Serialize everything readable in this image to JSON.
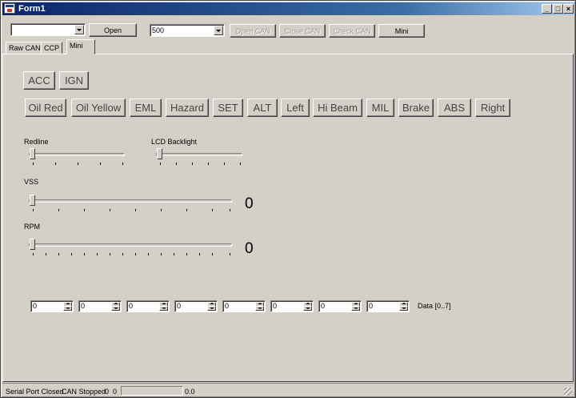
{
  "window": {
    "title": "Form1"
  },
  "toolbar": {
    "port_combo_value": "",
    "open_label": "Open",
    "baud_combo_value": "500",
    "open_can_label": "Open CAN",
    "close_can_label": "Close CAN",
    "check_can_label": "Check CAN",
    "mini_label": "Mini"
  },
  "tabs": [
    {
      "label": "Raw CAN"
    },
    {
      "label": "CCP"
    },
    {
      "label": "Mini",
      "active": true
    }
  ],
  "mini": {
    "power_buttons": [
      "ACC",
      "IGN"
    ],
    "indicator_buttons": [
      "Oil Red",
      "Oil Yellow",
      "EML",
      "Hazard",
      "SET",
      "ALT",
      "Left",
      "Hi Beam",
      "MIL",
      "Brake",
      "ABS",
      "Right"
    ],
    "redline": {
      "label": "Redline",
      "value": 0
    },
    "lcd_backlight": {
      "label": "LCD Backlight",
      "value": 0
    },
    "vss": {
      "label": "VSS",
      "value": 0,
      "display": "0"
    },
    "rpm": {
      "label": "RPM",
      "value": 0,
      "display": "0"
    },
    "data_bytes": [
      "0",
      "0",
      "0",
      "0",
      "0",
      "0",
      "0",
      "0"
    ],
    "data_label": "Data [0..7]"
  },
  "status": {
    "serial": "Serial Port Closed",
    "can": "CAN Stopped",
    "counter_a": "0",
    "counter_b": "0",
    "progress": 0,
    "rate": "0.0"
  }
}
